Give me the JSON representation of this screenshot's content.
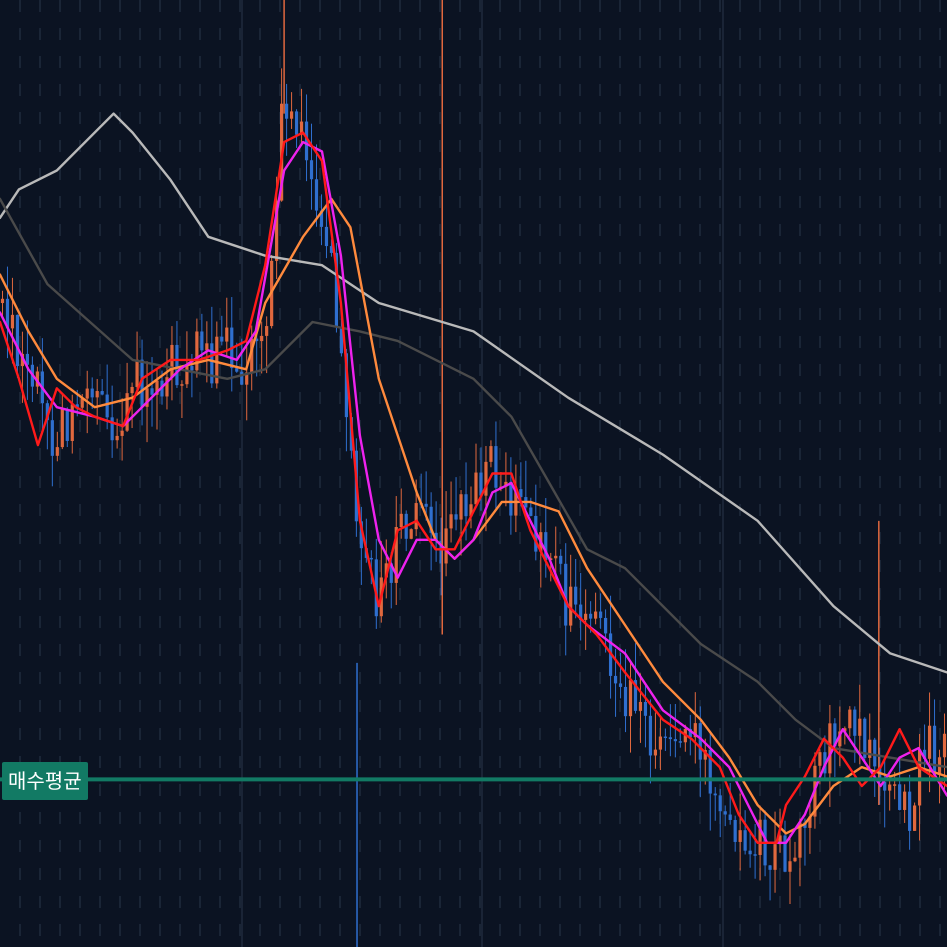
{
  "chart_data": {
    "type": "candlestick",
    "title": "",
    "xlabel": "",
    "ylabel": "",
    "ylim": [
      0,
      100
    ],
    "grid": true,
    "reference_line": {
      "label": "매수평균",
      "value": 17.7,
      "color": "#127a64"
    },
    "colors": {
      "background": "#0b1322",
      "up": "#e0683e",
      "down": "#2f6fcf",
      "grid": "#1b2738",
      "ma_fast": "#ff1a1a",
      "ma_mid": "#ee22ee",
      "ma_slow": "#ff8a3d",
      "ma_long_dark": "#4a4a4a",
      "ma_long_light": "#b9b9b9"
    },
    "price_path": [
      [
        0,
        68
      ],
      [
        3,
        62
      ],
      [
        5,
        54
      ],
      [
        7,
        56
      ],
      [
        10,
        57
      ],
      [
        12,
        55
      ],
      [
        14,
        60
      ],
      [
        16,
        57
      ],
      [
        18,
        61
      ],
      [
        20,
        62
      ],
      [
        22,
        62
      ],
      [
        24,
        63
      ],
      [
        26,
        62
      ],
      [
        28,
        64
      ],
      [
        30,
        90
      ],
      [
        31,
        86
      ],
      [
        33,
        82
      ],
      [
        35,
        72
      ],
      [
        37,
        55
      ],
      [
        38,
        40
      ],
      [
        40,
        37
      ],
      [
        42,
        43
      ],
      [
        44,
        45
      ],
      [
        46,
        43
      ],
      [
        47,
        42
      ],
      [
        48,
        44
      ],
      [
        50,
        48
      ],
      [
        52,
        51
      ],
      [
        54,
        47
      ],
      [
        56,
        46
      ],
      [
        58,
        40
      ],
      [
        60,
        36
      ],
      [
        62,
        34
      ],
      [
        64,
        33
      ],
      [
        66,
        27
      ],
      [
        68,
        23
      ],
      [
        70,
        22
      ],
      [
        72,
        22
      ],
      [
        74,
        21
      ],
      [
        76,
        17
      ],
      [
        78,
        13
      ],
      [
        80,
        12
      ],
      [
        82,
        10
      ],
      [
        84,
        11
      ],
      [
        86,
        17
      ],
      [
        88,
        22
      ],
      [
        90,
        23
      ],
      [
        92,
        20
      ],
      [
        94,
        17
      ],
      [
        96,
        15
      ],
      [
        98,
        21
      ],
      [
        100,
        20
      ]
    ],
    "moving_averages": [
      {
        "color_key": "ma_long_light",
        "values": [
          [
            0,
            77
          ],
          [
            2,
            80
          ],
          [
            6,
            82
          ],
          [
            12,
            88
          ],
          [
            14,
            86
          ],
          [
            18,
            81
          ],
          [
            22,
            75
          ],
          [
            28,
            73
          ],
          [
            34,
            72
          ],
          [
            40,
            68
          ],
          [
            50,
            65
          ],
          [
            60,
            58
          ],
          [
            70,
            52
          ],
          [
            80,
            45
          ],
          [
            88,
            36
          ],
          [
            94,
            31
          ],
          [
            100,
            29
          ]
        ]
      },
      {
        "color_key": "ma_long_dark",
        "values": [
          [
            0,
            79
          ],
          [
            5,
            70
          ],
          [
            14,
            62
          ],
          [
            24,
            60
          ],
          [
            28,
            61
          ],
          [
            33,
            66
          ],
          [
            38,
            65
          ],
          [
            42,
            64
          ],
          [
            50,
            60
          ],
          [
            54,
            56
          ],
          [
            58,
            49
          ],
          [
            62,
            42
          ],
          [
            66,
            40
          ],
          [
            70,
            36
          ],
          [
            74,
            32
          ],
          [
            80,
            28
          ],
          [
            84,
            24
          ],
          [
            88,
            21
          ],
          [
            94,
            20
          ],
          [
            100,
            19
          ]
        ]
      },
      {
        "color_key": "ma_slow",
        "values": [
          [
            0,
            71
          ],
          [
            3,
            65
          ],
          [
            6,
            60
          ],
          [
            10,
            57
          ],
          [
            14,
            58
          ],
          [
            18,
            61
          ],
          [
            22,
            62
          ],
          [
            26,
            61
          ],
          [
            28,
            68
          ],
          [
            32,
            75
          ],
          [
            35,
            79
          ],
          [
            37,
            76
          ],
          [
            40,
            60
          ],
          [
            44,
            48
          ],
          [
            46,
            43
          ],
          [
            48,
            41
          ],
          [
            50,
            43
          ],
          [
            53,
            47
          ],
          [
            56,
            47
          ],
          [
            59,
            46
          ],
          [
            62,
            40
          ],
          [
            66,
            34
          ],
          [
            70,
            28
          ],
          [
            74,
            24
          ],
          [
            77,
            20
          ],
          [
            80,
            15
          ],
          [
            83,
            12
          ],
          [
            85,
            13
          ],
          [
            88,
            17
          ],
          [
            91,
            19
          ],
          [
            94,
            18
          ],
          [
            97,
            19
          ],
          [
            100,
            18
          ]
        ]
      },
      {
        "color_key": "ma_mid",
        "values": [
          [
            0,
            67
          ],
          [
            3,
            61
          ],
          [
            6,
            57
          ],
          [
            10,
            56
          ],
          [
            13,
            55
          ],
          [
            16,
            58
          ],
          [
            19,
            61
          ],
          [
            22,
            63
          ],
          [
            25,
            62
          ],
          [
            27,
            65
          ],
          [
            30,
            82
          ],
          [
            32,
            85
          ],
          [
            34,
            84
          ],
          [
            36,
            73
          ],
          [
            38,
            54
          ],
          [
            40,
            43
          ],
          [
            42,
            39
          ],
          [
            44,
            43
          ],
          [
            46,
            43
          ],
          [
            48,
            41
          ],
          [
            50,
            43
          ],
          [
            52,
            48
          ],
          [
            54,
            49
          ],
          [
            56,
            45
          ],
          [
            58,
            41
          ],
          [
            60,
            36
          ],
          [
            62,
            34
          ],
          [
            66,
            31
          ],
          [
            70,
            25
          ],
          [
            74,
            22
          ],
          [
            77,
            19
          ],
          [
            79,
            15
          ],
          [
            81,
            11
          ],
          [
            83,
            11
          ],
          [
            85,
            14
          ],
          [
            87,
            19
          ],
          [
            89,
            23
          ],
          [
            91,
            20
          ],
          [
            93,
            17
          ],
          [
            95,
            20
          ],
          [
            97,
            21
          ],
          [
            100,
            16
          ]
        ]
      },
      {
        "color_key": "ma_fast",
        "values": [
          [
            0,
            66
          ],
          [
            2,
            60
          ],
          [
            4,
            53
          ],
          [
            6,
            59
          ],
          [
            8,
            57
          ],
          [
            10,
            56
          ],
          [
            13,
            55
          ],
          [
            15,
            60
          ],
          [
            18,
            62
          ],
          [
            21,
            62
          ],
          [
            24,
            63
          ],
          [
            26,
            64
          ],
          [
            28,
            72
          ],
          [
            30,
            85
          ],
          [
            32,
            86
          ],
          [
            34,
            83
          ],
          [
            36,
            68
          ],
          [
            38,
            45
          ],
          [
            40,
            36
          ],
          [
            42,
            44
          ],
          [
            44,
            45
          ],
          [
            46,
            42
          ],
          [
            48,
            42
          ],
          [
            50,
            46
          ],
          [
            52,
            50
          ],
          [
            54,
            50
          ],
          [
            56,
            44
          ],
          [
            58,
            40
          ],
          [
            60,
            36
          ],
          [
            63,
            33
          ],
          [
            66,
            29
          ],
          [
            70,
            24
          ],
          [
            73,
            22
          ],
          [
            76,
            19
          ],
          [
            78,
            14
          ],
          [
            80,
            11
          ],
          [
            82,
            11
          ],
          [
            83,
            15
          ],
          [
            85,
            18
          ],
          [
            87,
            22
          ],
          [
            89,
            20
          ],
          [
            91,
            17
          ],
          [
            93,
            19
          ],
          [
            95,
            23
          ],
          [
            97,
            19
          ],
          [
            100,
            17
          ]
        ]
      }
    ]
  }
}
